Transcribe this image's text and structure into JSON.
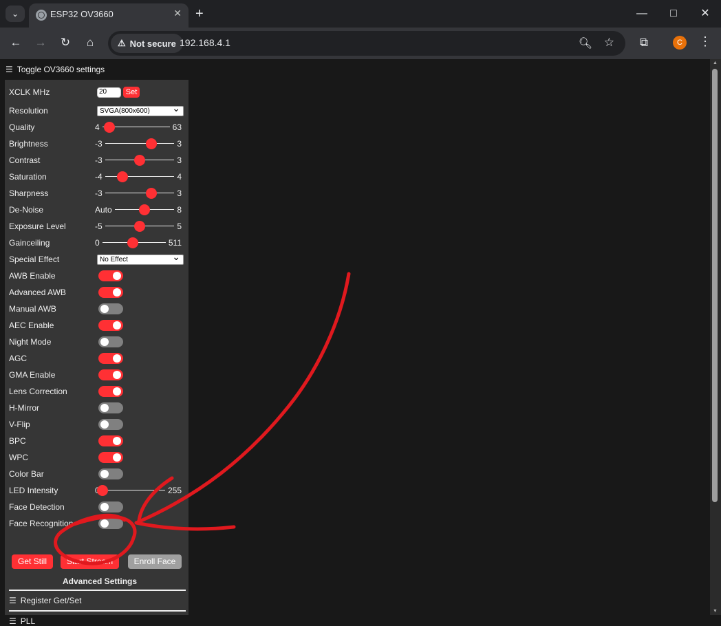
{
  "browser": {
    "tab_title": "ESP32 OV3660",
    "close_tab": "✕",
    "new_tab": "+",
    "security_label": "Not secure",
    "url": "192.168.4.1",
    "profile_initial": "C",
    "minimize": "—",
    "maximize": "□",
    "close": "✕"
  },
  "page": {
    "toggle_settings": "Toggle OV3660 settings",
    "xclk_label": "XCLK MHz",
    "xclk_value": "20",
    "set_button": "Set",
    "resolution_label": "Resolution",
    "resolution_value": "SVGA(800x600)",
    "quality": {
      "label": "Quality",
      "min": "4",
      "max": "63",
      "value": 10
    },
    "brightness": {
      "label": "Brightness",
      "min": "-3",
      "max": "3",
      "value": 1
    },
    "contrast": {
      "label": "Contrast",
      "min": "-3",
      "max": "3",
      "value": 0
    },
    "saturation": {
      "label": "Saturation",
      "min": "-4",
      "max": "4",
      "value": -2
    },
    "sharpness": {
      "label": "Sharpness",
      "min": "-3",
      "max": "3",
      "value": 1
    },
    "denoise": {
      "label": "De-Noise",
      "min": "Auto",
      "max": "8",
      "value": 4
    },
    "exposure": {
      "label": "Exposure Level",
      "min": "-5",
      "max": "5",
      "value": 0
    },
    "gainceiling": {
      "label": "Gainceiling",
      "min": "0",
      "max": "511",
      "value": 248
    },
    "special_effect_label": "Special Effect",
    "special_effect_value": "No Effect",
    "toggles": [
      {
        "label": "AWB Enable",
        "on": true
      },
      {
        "label": "Advanced AWB",
        "on": true
      },
      {
        "label": "Manual AWB",
        "on": false
      },
      {
        "label": "AEC Enable",
        "on": true
      },
      {
        "label": "Night Mode",
        "on": false
      },
      {
        "label": "AGC",
        "on": true
      },
      {
        "label": "GMA Enable",
        "on": true
      },
      {
        "label": "Lens Correction",
        "on": true
      },
      {
        "label": "H-Mirror",
        "on": false
      },
      {
        "label": "V-Flip",
        "on": false
      },
      {
        "label": "BPC",
        "on": true
      },
      {
        "label": "WPC",
        "on": true
      },
      {
        "label": "Color Bar",
        "on": false
      }
    ],
    "led": {
      "label": "LED Intensity",
      "min": "0",
      "max": "255",
      "value": 0
    },
    "face_detection": {
      "label": "Face Detection",
      "on": false
    },
    "face_recognition": {
      "label": "Face Recognition",
      "on": false
    },
    "get_still": "Get Still",
    "start_stream": "Start Stream",
    "enroll_face": "Enroll Face",
    "advanced_settings": "Advanced Settings",
    "register_get_set": "Register Get/Set",
    "pll": "PLL"
  },
  "colors": {
    "accent": "#ff3034",
    "panel": "#363636",
    "page_bg": "#181818",
    "annotation": "#e0191e"
  }
}
